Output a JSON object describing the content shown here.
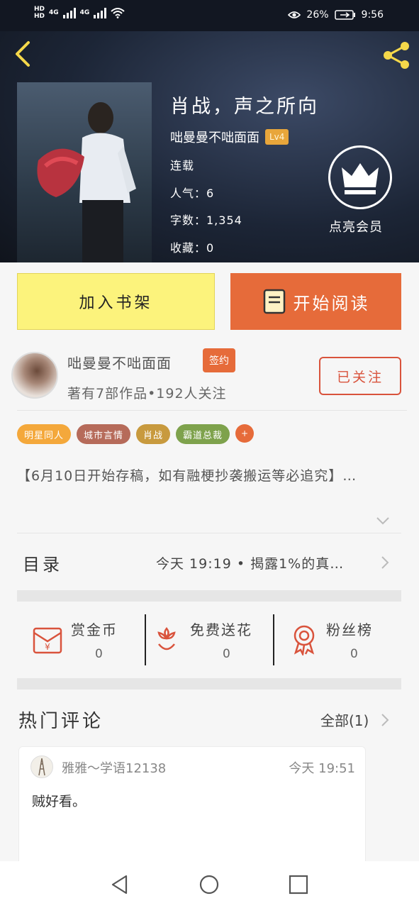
{
  "status_bar": {
    "hd_top": "HD",
    "hd_bottom": "HD",
    "net1": "4G",
    "net2": "4G",
    "battery": "26%",
    "time": "9:56"
  },
  "book": {
    "title": "肖战，声之所向",
    "author": "咄曼曼不咄面面",
    "level": "Lv4",
    "status": "连载",
    "popularity": "人气：6",
    "word_count": "字数：1,354",
    "favorites": "收藏：0",
    "vip_label": "点亮会员"
  },
  "actions": {
    "add_shelf": "加入书架",
    "start_read": "开始阅读"
  },
  "author_panel": {
    "name": "咄曼曼不咄面面",
    "signed": "签约",
    "stats": "著有7部作品•192人关注",
    "follow": "已关注"
  },
  "tags": [
    {
      "label": "明星同人",
      "color": "#f4a83b"
    },
    {
      "label": "城市言情",
      "color": "#b66b5a"
    },
    {
      "label": "肖战",
      "color": "#c89a3e"
    },
    {
      "label": "霸道总裁",
      "color": "#7ea24c"
    }
  ],
  "tag_more": "+",
  "synopsis": "【6月10日开始存稿，如有融梗抄袭搬运等必追究】…",
  "catalog": {
    "label": "目录",
    "latest": "今天 19:19 • 揭露1%的真…"
  },
  "rewards": [
    {
      "label": "赏金币",
      "count": "0"
    },
    {
      "label": "免费送花",
      "count": "0"
    },
    {
      "label": "粉丝榜",
      "count": "0"
    }
  ],
  "comments": {
    "title": "热门评论",
    "all": "全部(1)",
    "items": [
      {
        "user": "雅雅～学语12138",
        "time": "今天 19:51",
        "text": "贼好看。"
      }
    ]
  },
  "colors": {
    "accent": "#e66b3a",
    "shelf_yellow": "#fcf37c",
    "follow_red": "#d9533c",
    "lv_badge": "#e8a63b"
  }
}
